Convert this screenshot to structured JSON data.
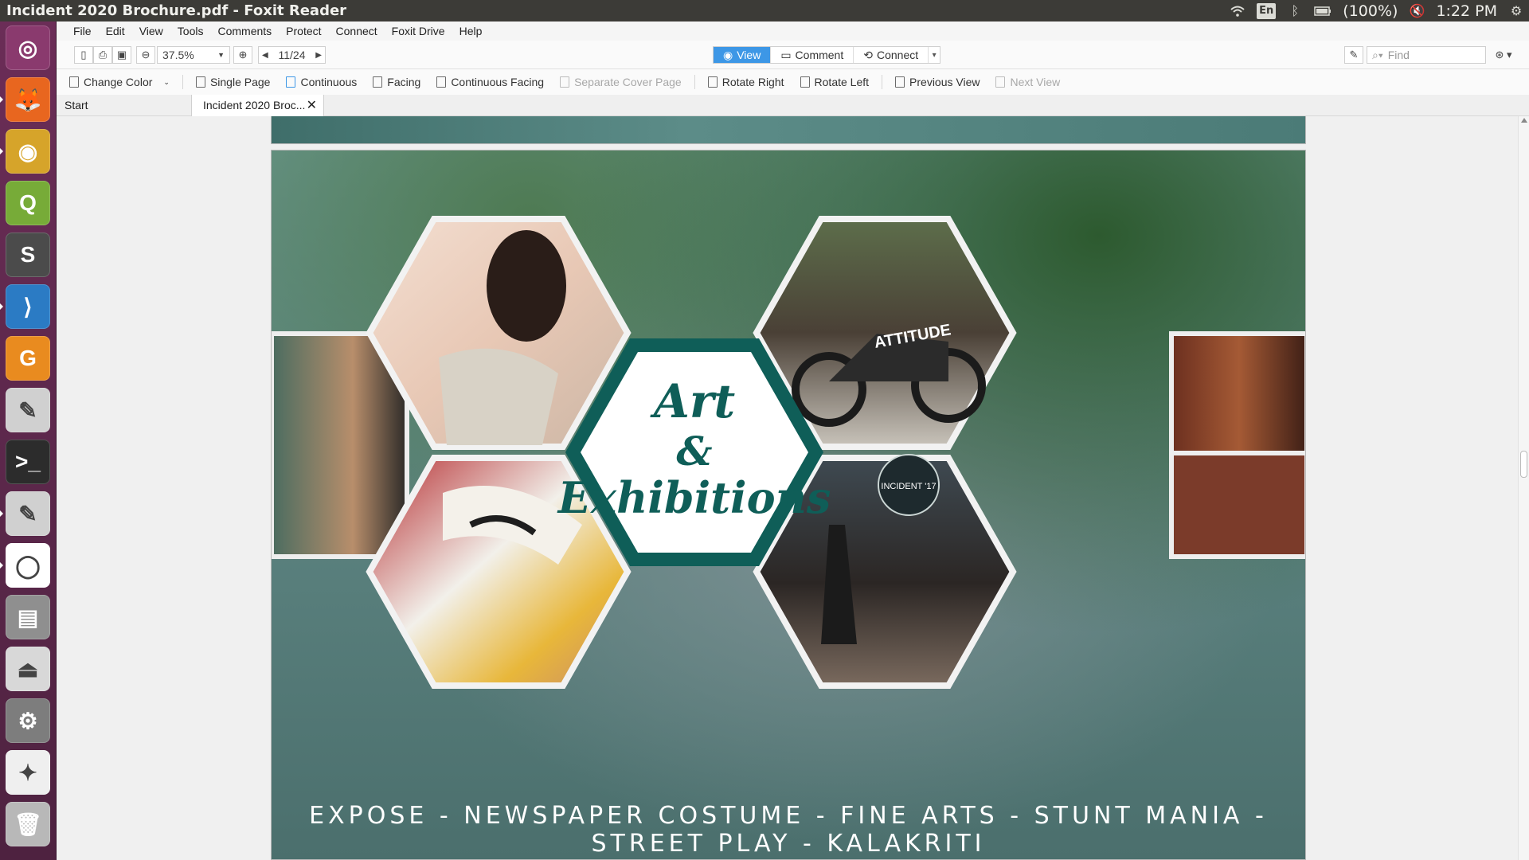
{
  "window": {
    "title": "Incident 2020 Brochure.pdf - Foxit Reader"
  },
  "system_tray": {
    "language": "En",
    "battery": "(100%)",
    "time": "1:22 PM"
  },
  "launcher": {
    "items": [
      {
        "name": "ubuntu-dash",
        "glyph": "◎",
        "bg": "#8a3a6e"
      },
      {
        "name": "firefox",
        "glyph": "🦊",
        "bg": "#e8661f"
      },
      {
        "name": "chrome",
        "glyph": "◉",
        "bg": "#d6a42a"
      },
      {
        "name": "qgis",
        "glyph": "Q",
        "bg": "#77ab38"
      },
      {
        "name": "sublime-text",
        "glyph": "S",
        "bg": "#4b4b4b"
      },
      {
        "name": "vscode",
        "glyph": "⟩",
        "bg": "#2b7bc4"
      },
      {
        "name": "foxit-reader",
        "glyph": "G",
        "bg": "#e98b1f"
      },
      {
        "name": "text-editor",
        "glyph": "✎",
        "bg": "#d0d0d0"
      },
      {
        "name": "terminal",
        "glyph": ">_",
        "bg": "#2c2c2c"
      },
      {
        "name": "text-editor-2",
        "glyph": "✎",
        "bg": "#d0d0d0"
      },
      {
        "name": "app-circle",
        "glyph": "◯",
        "bg": "#ffffff"
      },
      {
        "name": "file-manager",
        "glyph": "▤",
        "bg": "#8f8f8f"
      },
      {
        "name": "disk",
        "glyph": "⏏",
        "bg": "#d8d8d8"
      },
      {
        "name": "system-settings",
        "glyph": "⚙",
        "bg": "#7d7d7d"
      },
      {
        "name": "custom-app",
        "glyph": "✦",
        "bg": "#efefef"
      },
      {
        "name": "trash",
        "glyph": "🗑",
        "bg": "#b8b8b8"
      }
    ]
  },
  "menubar": {
    "items": [
      "File",
      "Edit",
      "View",
      "Tools",
      "Comments",
      "Protect",
      "Connect",
      "Foxit Drive",
      "Help"
    ]
  },
  "toolbar": {
    "zoom": "37.5%",
    "page": "11/24",
    "modes": [
      "View",
      "Comment",
      "Connect"
    ],
    "active_mode": "View",
    "find_placeholder": "Find"
  },
  "view_toolbar": {
    "change_color": "Change Color",
    "single_page": "Single Page",
    "continuous": "Continuous",
    "facing": "Facing",
    "continuous_facing": "Continuous Facing",
    "separate_cover": "Separate Cover Page",
    "rotate_right": "Rotate Right",
    "rotate_left": "Rotate Left",
    "previous_view": "Previous View",
    "next_view": "Next View"
  },
  "tabs": {
    "start": "Start",
    "document": "Incident 2020 Broc..."
  },
  "page_content": {
    "heading_line1": "Art",
    "heading_line2": "&",
    "heading_line3": "Exhibitions",
    "caption": "EXPOSE - NEWSPAPER COSTUME - FINE ARTS - STUNT MANIA - STREET PLAY - KALAKRITI",
    "accent_color": "#0f5e58"
  }
}
